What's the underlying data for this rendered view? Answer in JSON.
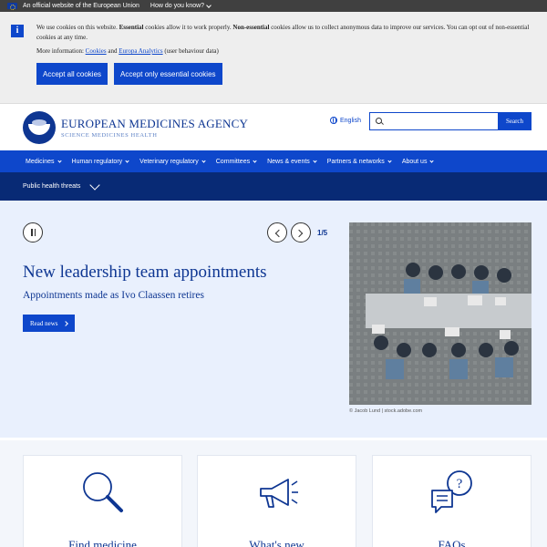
{
  "eu_bar": {
    "official_text": "An official website of the European Union",
    "how_know": "How do you know?"
  },
  "cookie": {
    "text_1": "We use cookies on this website. ",
    "essential_bold": "Essential",
    "text_2": " cookies allow it to work properly. ",
    "nonessential_bold": "Non-essential",
    "text_3": " cookies allow us to collect anonymous data to improve our services. You can opt out of non-essential cookies at any time.",
    "more_info_prefix": "More information: ",
    "cookies_link": "Cookies",
    "and_text": " and ",
    "analytics_link": "Europa Analytics",
    "analytics_suffix": " (user behaviour data)",
    "accept_all": "Accept all cookies",
    "accept_essential": "Accept only essential cookies"
  },
  "header": {
    "logo_line1": "EUROPEAN MEDICINES AGENCY",
    "logo_line2": "SCIENCE  MEDICINES  HEALTH",
    "language": "English",
    "search_placeholder": "",
    "search_button": "Search"
  },
  "nav": {
    "items": [
      {
        "label": "Medicines"
      },
      {
        "label": "Human regulatory"
      },
      {
        "label": "Veterinary regulatory"
      },
      {
        "label": "Committees"
      },
      {
        "label": "News & events"
      },
      {
        "label": "Partners & networks"
      },
      {
        "label": "About us"
      }
    ],
    "sub_label": "Public health threats"
  },
  "hero": {
    "counter": "1/5",
    "title": "New leadership team appointments",
    "subtitle": "Appointments made as Ivo Claassen retires",
    "read_news": "Read news",
    "credit": "© Jacob Lund | stock.adobe.com"
  },
  "cards": [
    {
      "title": "Find medicine",
      "icon": "magnifier-icon"
    },
    {
      "title": "What's new",
      "icon": "megaphone-icon"
    },
    {
      "title": "FAQs",
      "icon": "speech-bubbles-icon"
    }
  ],
  "colors": {
    "primary": "#0e47cb",
    "dark_blue": "#0e3692",
    "subnav": "#082a75",
    "hero_bg": "#e9f0fd",
    "eu_bar": "#404040",
    "cookie_bg": "#eeeeee"
  }
}
